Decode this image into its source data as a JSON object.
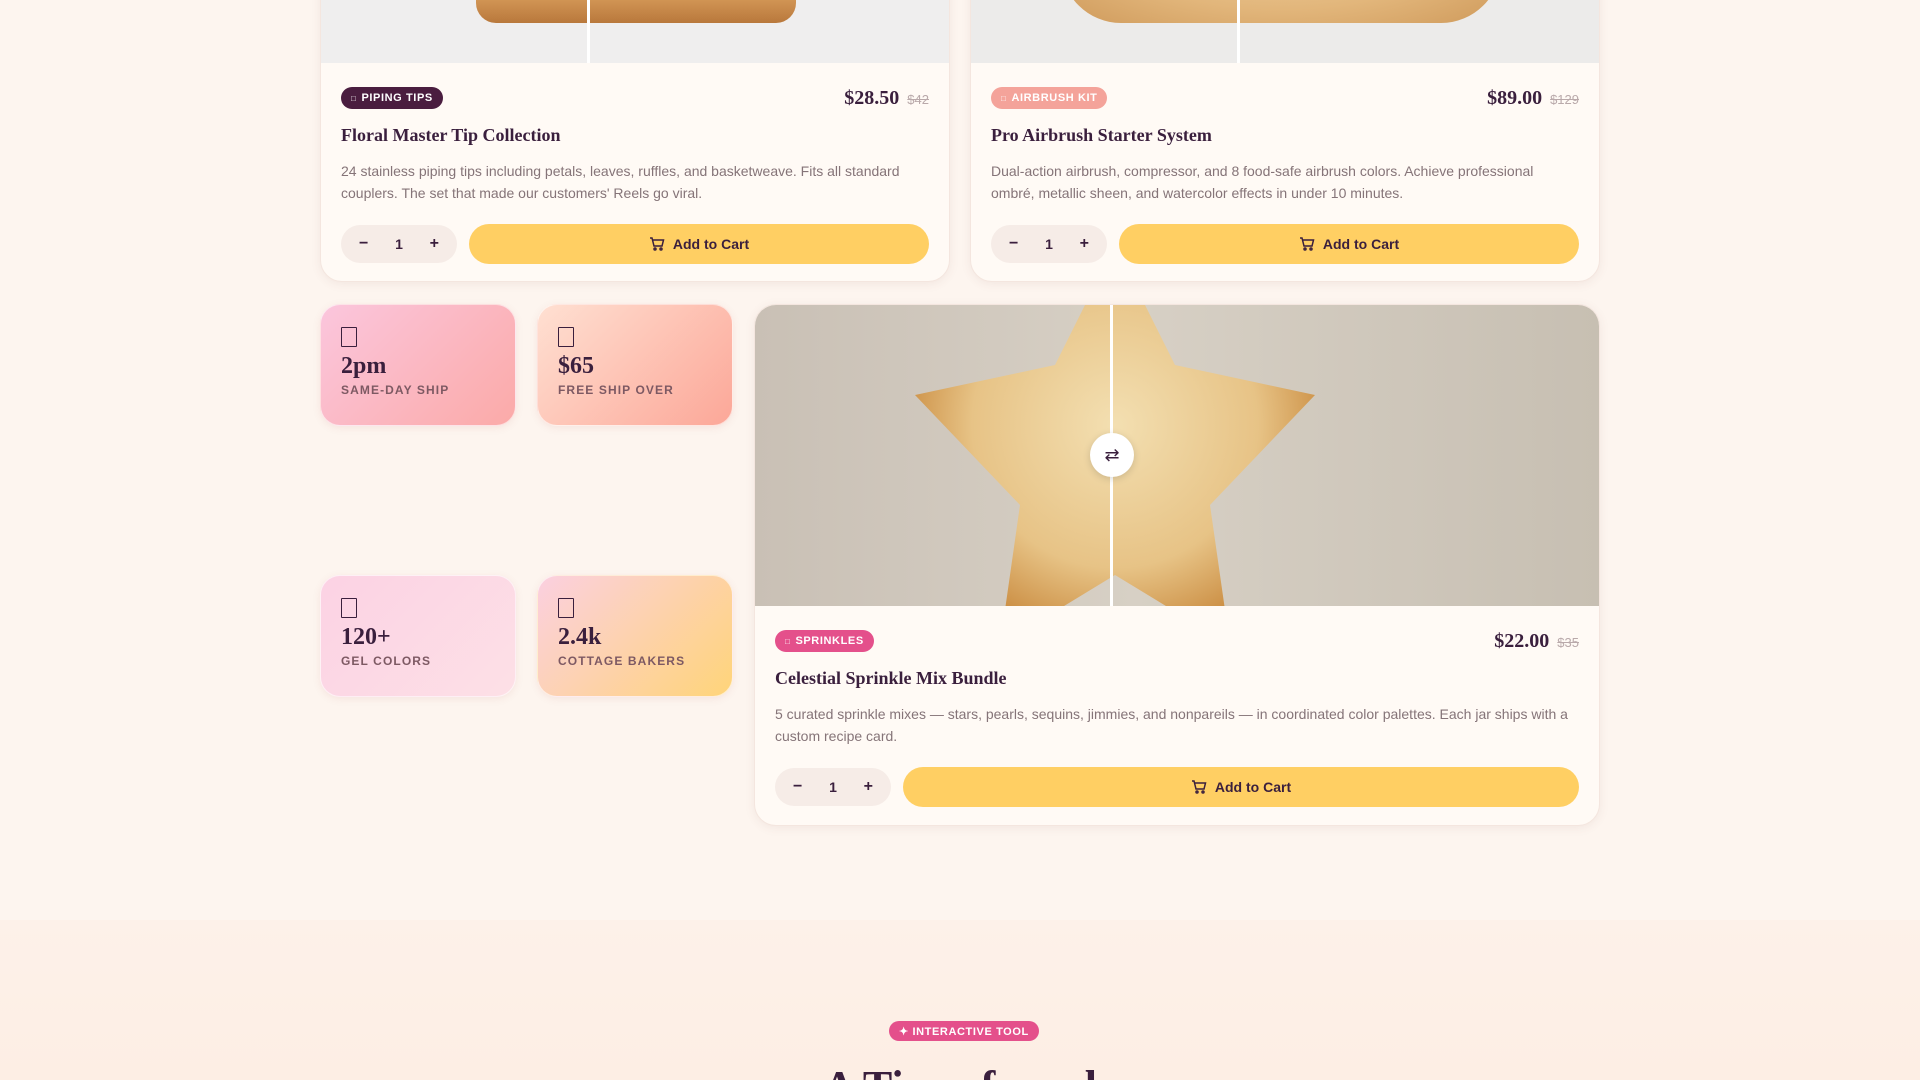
{
  "products": [
    {
      "badge": "PIPING TIPS",
      "badge_color": "#4a1d3f",
      "price": "$28.50",
      "old_price": "$42",
      "title": "Floral Master Tip Collection",
      "description": "24 stainless piping tips including petals, leaves, ruffles, and basketweave. Fits all standard couplers. The set that made our customers' Reels go viral.",
      "quantity": "1",
      "add_label": "Add to Cart"
    },
    {
      "badge": "AIRBRUSH KIT",
      "badge_color": "#f4a39a",
      "price": "$89.00",
      "old_price": "$129",
      "title": "Pro Airbrush Starter System",
      "description": "Dual-action airbrush, compressor, and 8 food-safe airbrush colors. Achieve professional ombré, metallic sheen, and watercolor effects in under 10 minutes.",
      "quantity": "1",
      "add_label": "Add to Cart"
    },
    {
      "badge": "SPRINKLES",
      "badge_color": "#e4508b",
      "price": "$22.00",
      "old_price": "$35",
      "title": "Celestial Sprinkle Mix Bundle",
      "description": "5 curated sprinkle mixes — stars, pearls, sequins, jimmies, and nonpareils — in coordinated color palettes. Each jar ships with a custom recipe card.",
      "quantity": "1",
      "add_label": "Add to Cart"
    }
  ],
  "stats": [
    {
      "value": "2pm",
      "label": "SAME-DAY SHIP",
      "icon": "box-icon"
    },
    {
      "value": "$65",
      "label": "FREE SHIP OVER",
      "icon": "box-icon"
    },
    {
      "value": "120+",
      "label": "GEL COLORS",
      "icon": "box-icon"
    },
    {
      "value": "2.4k",
      "label": "COTTAGE BAKERS",
      "icon": "box-icon"
    }
  ],
  "qty_controls": {
    "minus": "−",
    "plus": "+"
  },
  "compare_slider_icon": "⇄",
  "section": {
    "badge": "✦ INTERACTIVE TOOL",
    "heading_partial": "A Ti... ...f... ...d"
  }
}
